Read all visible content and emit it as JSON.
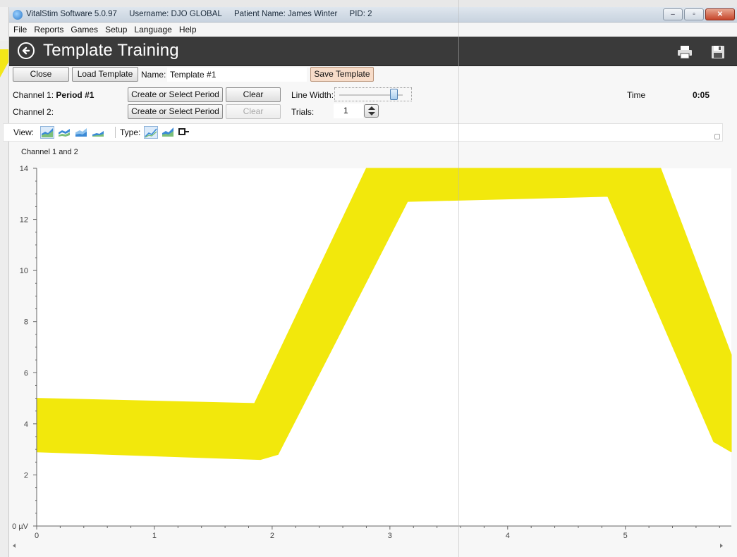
{
  "window": {
    "title_app": "VitalStim Software 5.0.97",
    "title_user": "Username: DJO GLOBAL",
    "title_patient": "Patient Name: James Winter",
    "title_pid": "PID: 2",
    "minimize": "‒",
    "maximize": "▫",
    "close": "✕"
  },
  "menu": [
    "File",
    "Reports",
    "Games",
    "Setup",
    "Language",
    "Help"
  ],
  "header": {
    "title": "Template Training",
    "icons": [
      "back-icon",
      "print-icon",
      "save-icon"
    ]
  },
  "toolbar": {
    "close_label": "Close",
    "load_label": "Load Template",
    "name_label": "Name:",
    "name_value": "Template #1",
    "save_label": "Save Template"
  },
  "channels": {
    "ch1_label": "Channel 1:",
    "ch1_value": "Period #1",
    "ch2_label": "Channel 2:",
    "create_label": "Create or Select Period",
    "clear_label": "Clear",
    "line_width_label": "Line Width:",
    "line_width_fraction": 0.85,
    "trials_label": "Trials:",
    "trials_value": "1",
    "time_label": "Time",
    "time_value": "0:05"
  },
  "viewbar": {
    "view_label": "View:",
    "type_label": "Type:",
    "view_icons": [
      "area-chart-icon",
      "stacked-area-icon",
      "area-outline-icon",
      "small-area-icon"
    ],
    "type_icons": [
      "line-chart-icon",
      "area-chart-icon",
      "settings-plug-icon"
    ]
  },
  "colors": {
    "band": "#f2e80c",
    "header_bg": "#3a3a3a",
    "save_btn": "#f7dcc9"
  },
  "chart_data": {
    "type": "area",
    "title": "Channel 1 and 2",
    "x_ticks": [
      "0",
      "1",
      "2",
      "3",
      "4",
      "5"
    ],
    "y_ticks": [
      "0 µV",
      "2",
      "4",
      "6",
      "8",
      "10",
      "12",
      "14"
    ],
    "xlim": [
      0,
      5.9
    ],
    "ylim": [
      0,
      14
    ],
    "series": [
      {
        "upper": [
          [
            0,
            5.0
          ],
          [
            1.85,
            4.8
          ],
          [
            2.8,
            14
          ],
          [
            5.3,
            14
          ],
          [
            5.9,
            6.7
          ]
        ],
        "lower": [
          [
            0,
            2.9
          ],
          [
            1.9,
            2.6
          ],
          [
            2.05,
            2.8
          ],
          [
            3.15,
            12.7
          ],
          [
            4.85,
            12.9
          ],
          [
            5.75,
            3.3
          ],
          [
            5.9,
            2.9
          ]
        ]
      }
    ]
  }
}
